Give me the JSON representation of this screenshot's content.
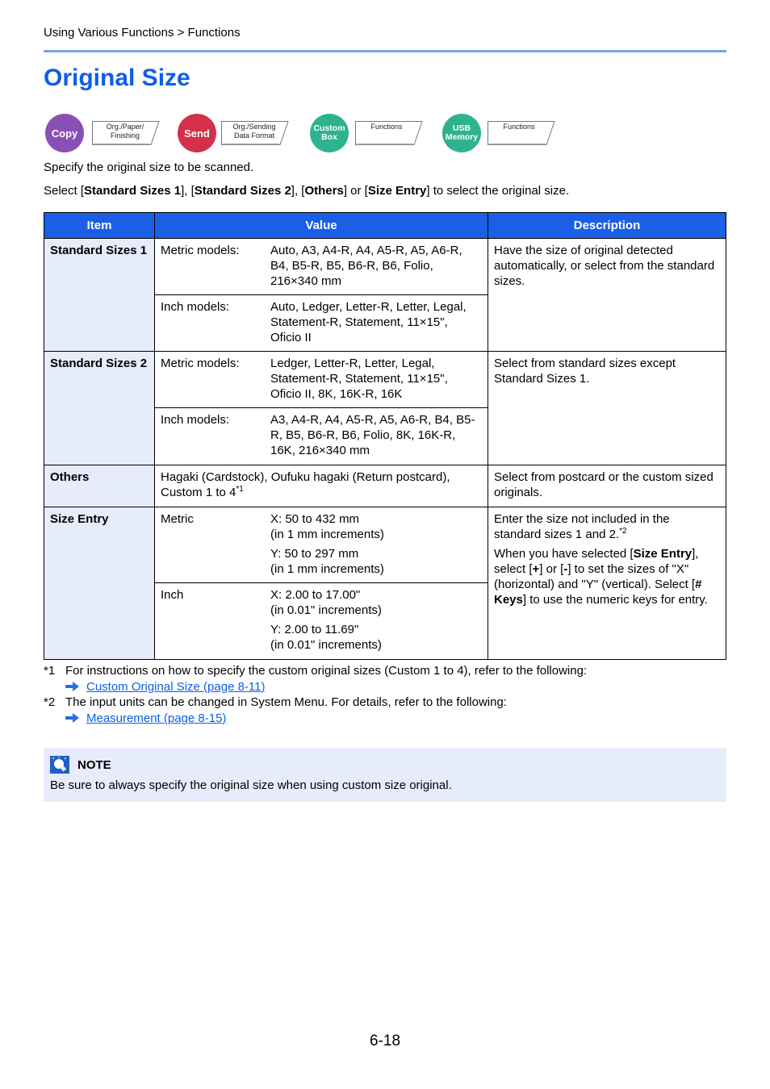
{
  "breadcrumb": "Using Various Functions > Functions",
  "page_title": "Original Size",
  "functions": [
    {
      "mode": "Copy",
      "color": "#8a4fb5",
      "tag": "Org./Paper/\nFinishing"
    },
    {
      "mode": "Send",
      "color": "#d4304a",
      "tag": "Org./Sending\nData Format"
    },
    {
      "mode": "Custom\nBox",
      "color": "#2fb38e",
      "tag": "Functions"
    },
    {
      "mode": "USB\nMemory",
      "color": "#2fb38e",
      "tag": "Functions"
    }
  ],
  "intro": {
    "line1": "Specify the original size to be scanned.",
    "line2": {
      "p1": "Select [",
      "b1": "Standard Sizes 1",
      "p2": "], [",
      "b2": "Standard Sizes 2",
      "p3": "], [",
      "b3": "Others",
      "p4": "] or [",
      "b4": "Size Entry",
      "p5": "] to select the original size."
    }
  },
  "table": {
    "headers": {
      "item": "Item",
      "value": "Value",
      "description": "Description"
    },
    "rows": {
      "std1": {
        "item": "Standard Sizes 1",
        "metric_label": "Metric models:",
        "metric_value": "Auto, A3, A4-R, A4, A5-R, A5, A6-R, B4, B5-R, B5, B6-R, B6, Folio, 216×340  mm",
        "inch_label": "Inch models:",
        "inch_value": "Auto, Ledger, Letter-R, Letter, Legal, Statement-R, Statement, 11×15\", Oficio II",
        "description": "Have the size of original detected automatically, or select from the standard sizes."
      },
      "std2": {
        "item": "Standard Sizes 2",
        "metric_label": "Metric models:",
        "metric_value": "Ledger, Letter-R, Letter, Legal, Statement-R, Statement, 11×15\", Oficio II, 8K, 16K-R, 16K",
        "inch_label": "Inch models:",
        "inch_value": "A3, A4-R, A4, A5-R, A5, A6-R, B4, B5-R, B5, B6-R, B6, Folio, 8K, 16K-R, 16K, 216×340 mm",
        "description": "Select from standard sizes except Standard Sizes 1."
      },
      "others": {
        "item": "Others",
        "value": "Hagaki (Cardstock), Oufuku hagaki (Return postcard), Custom 1 to 4",
        "value_sup": "*1",
        "description": "Select from postcard or the custom sized originals."
      },
      "size_entry": {
        "item": "Size Entry",
        "metric_label": "Metric",
        "metric_x": "X: 50 to 432 mm",
        "metric_x_inc": "(in 1 mm increments)",
        "metric_y": "Y: 50 to 297 mm",
        "metric_y_inc": "(in 1 mm increments)",
        "inch_label": "Inch",
        "inch_x": "X: 2.00 to 17.00\"",
        "inch_x_inc": "(in 0.01\" increments)",
        "inch_y": "Y: 2.00 to 11.69\"",
        "inch_y_inc": "(in 0.01\" increments)",
        "desc1": "Enter the size not included in the standard sizes 1 and 2.",
        "desc1_sup": "*2",
        "desc2": {
          "p1": "When you have selected [",
          "b1": "Size Entry",
          "p2": "], select [",
          "b2": "+",
          "p3": "] or [",
          "b3": "-",
          "p4": "] to set the sizes of \"X\" (horizontal) and \"Y\" (vertical). Select [",
          "b4": "# Keys",
          "p5": "] to use the numeric keys for entry."
        }
      }
    }
  },
  "footnotes": [
    {
      "mark": "*1",
      "text": "For instructions on how to specify the custom original sizes (Custom 1 to 4), refer to the following:",
      "link": "Custom Original Size (page 8-11)"
    },
    {
      "mark": "*2",
      "text": "The input units can be changed in System Menu. For details, refer to the following:",
      "link": "Measurement (page 8-15)"
    }
  ],
  "note": {
    "heading": "NOTE",
    "text": "Be sure to always specify the original size when using custom size original."
  },
  "page_number": "6-18",
  "colors": {
    "accent": "#0d5ee8",
    "header_bg": "#1a5fe6",
    "item_bg": "#e6ecfa"
  }
}
